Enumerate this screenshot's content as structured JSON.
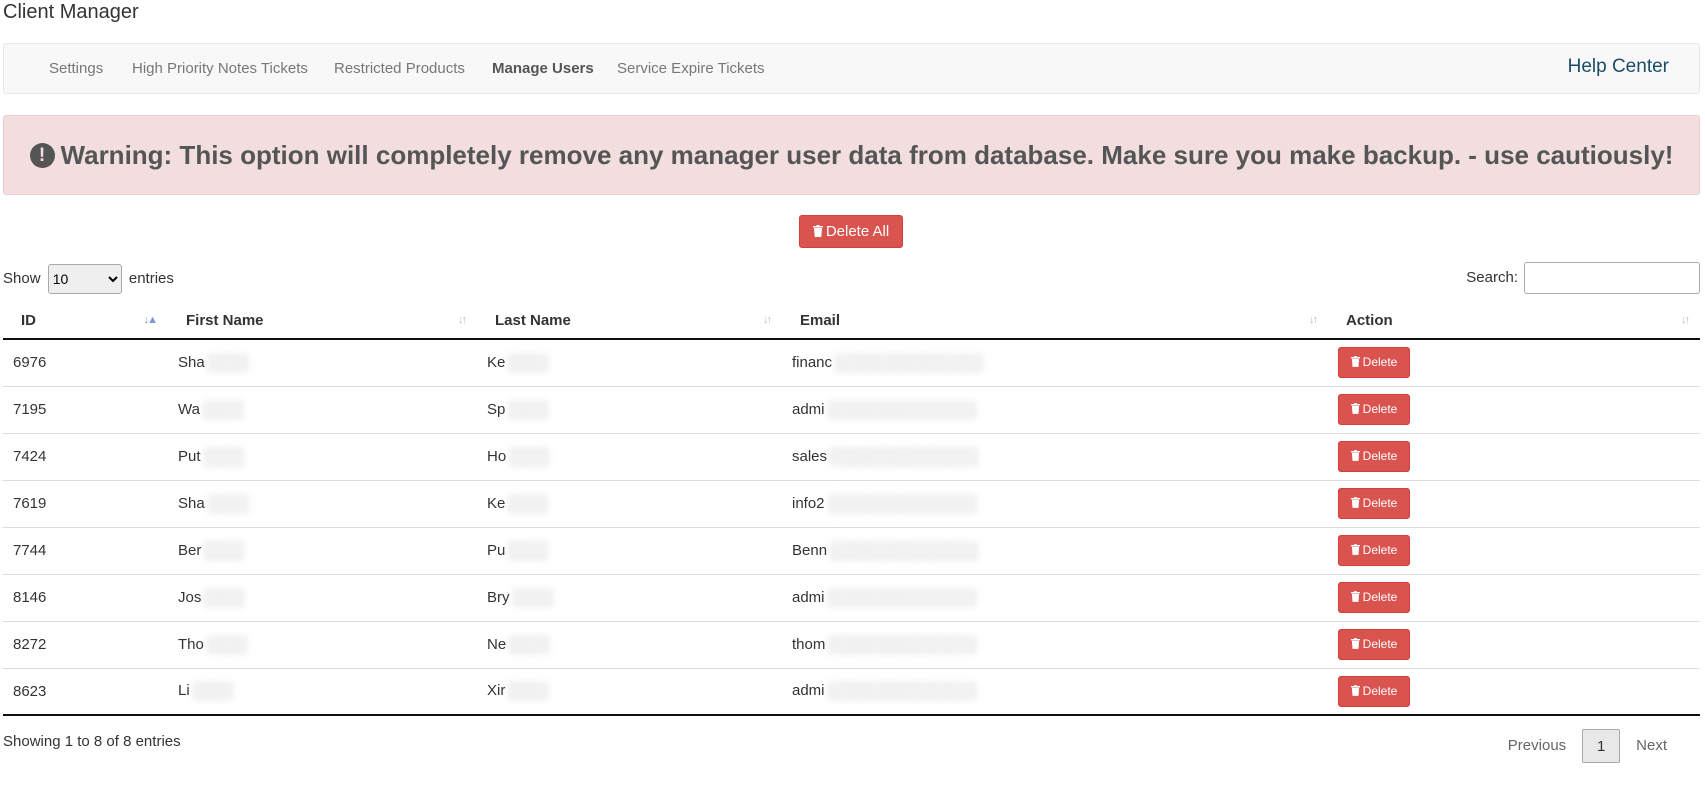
{
  "header": {
    "title": "Client Manager"
  },
  "nav": {
    "items": [
      {
        "label": "Settings"
      },
      {
        "label": "High Priority Notes Tickets"
      },
      {
        "label": "Restricted Products"
      },
      {
        "label": "Manage Users"
      },
      {
        "label": "Service Expire Tickets"
      }
    ],
    "active": "Manage Users",
    "help_label": "Help Center"
  },
  "alert": {
    "icon": "exclamation-circle-icon",
    "text": "Warning: This option will completely remove any manager user data from database. Make sure you make backup. - use cautiously!"
  },
  "delete_all": {
    "label": "Delete All",
    "icon": "trash-icon"
  },
  "length_control": {
    "prefix": "Show",
    "selected": "10",
    "options": [
      "10"
    ],
    "suffix": "entries"
  },
  "search": {
    "label": "Search:",
    "value": ""
  },
  "table": {
    "columns": [
      "ID",
      "First Name",
      "Last Name",
      "Email",
      "Action"
    ],
    "sort": {
      "column": "ID",
      "direction": "asc"
    },
    "rows": [
      {
        "id": "6976",
        "first": "Sha",
        "last": "Ke",
        "email": "financ",
        "action": "Delete"
      },
      {
        "id": "7195",
        "first": "Wa",
        "last": "Sp",
        "email": "admi",
        "action": "Delete"
      },
      {
        "id": "7424",
        "first": "Put",
        "last": "Ho",
        "email": "sales",
        "action": "Delete"
      },
      {
        "id": "7619",
        "first": "Sha",
        "last": "Ke",
        "email": "info2",
        "action": "Delete"
      },
      {
        "id": "7744",
        "first": "Ber",
        "last": "Pu",
        "email": "Benn",
        "action": "Delete"
      },
      {
        "id": "8146",
        "first": "Jos",
        "last": "Bry",
        "email": "admi",
        "action": "Delete"
      },
      {
        "id": "8272",
        "first": "Tho",
        "last": "Ne",
        "email": "thom",
        "action": "Delete"
      },
      {
        "id": "8623",
        "first": "Li",
        "last": "Xir",
        "email": "admi",
        "action": "Delete"
      }
    ]
  },
  "footer": {
    "info": "Showing 1 to 8 of 8 entries",
    "previous": "Previous",
    "current_page": "1",
    "next": "Next"
  },
  "colors": {
    "danger": "#d9534f",
    "alert_bg": "#f2dede",
    "help_link": "#1a4d66"
  }
}
